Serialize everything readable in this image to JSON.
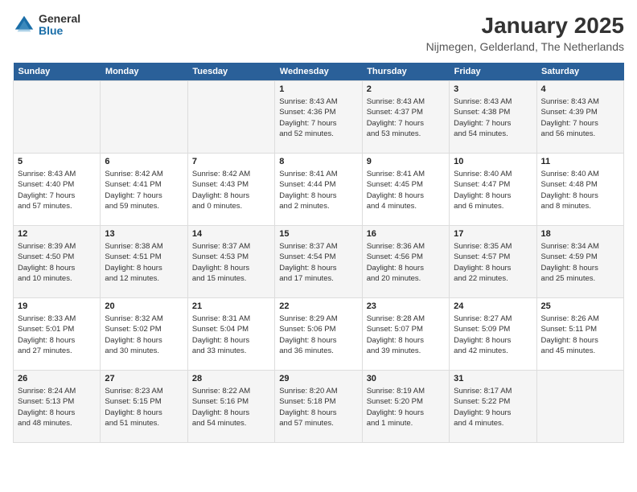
{
  "logo": {
    "general": "General",
    "blue": "Blue"
  },
  "title": "January 2025",
  "subtitle": "Nijmegen, Gelderland, The Netherlands",
  "weekdays": [
    "Sunday",
    "Monday",
    "Tuesday",
    "Wednesday",
    "Thursday",
    "Friday",
    "Saturday"
  ],
  "weeks": [
    [
      {
        "day": "",
        "info": ""
      },
      {
        "day": "",
        "info": ""
      },
      {
        "day": "",
        "info": ""
      },
      {
        "day": "1",
        "info": "Sunrise: 8:43 AM\nSunset: 4:36 PM\nDaylight: 7 hours\nand 52 minutes."
      },
      {
        "day": "2",
        "info": "Sunrise: 8:43 AM\nSunset: 4:37 PM\nDaylight: 7 hours\nand 53 minutes."
      },
      {
        "day": "3",
        "info": "Sunrise: 8:43 AM\nSunset: 4:38 PM\nDaylight: 7 hours\nand 54 minutes."
      },
      {
        "day": "4",
        "info": "Sunrise: 8:43 AM\nSunset: 4:39 PM\nDaylight: 7 hours\nand 56 minutes."
      }
    ],
    [
      {
        "day": "5",
        "info": "Sunrise: 8:43 AM\nSunset: 4:40 PM\nDaylight: 7 hours\nand 57 minutes."
      },
      {
        "day": "6",
        "info": "Sunrise: 8:42 AM\nSunset: 4:41 PM\nDaylight: 7 hours\nand 59 minutes."
      },
      {
        "day": "7",
        "info": "Sunrise: 8:42 AM\nSunset: 4:43 PM\nDaylight: 8 hours\nand 0 minutes."
      },
      {
        "day": "8",
        "info": "Sunrise: 8:41 AM\nSunset: 4:44 PM\nDaylight: 8 hours\nand 2 minutes."
      },
      {
        "day": "9",
        "info": "Sunrise: 8:41 AM\nSunset: 4:45 PM\nDaylight: 8 hours\nand 4 minutes."
      },
      {
        "day": "10",
        "info": "Sunrise: 8:40 AM\nSunset: 4:47 PM\nDaylight: 8 hours\nand 6 minutes."
      },
      {
        "day": "11",
        "info": "Sunrise: 8:40 AM\nSunset: 4:48 PM\nDaylight: 8 hours\nand 8 minutes."
      }
    ],
    [
      {
        "day": "12",
        "info": "Sunrise: 8:39 AM\nSunset: 4:50 PM\nDaylight: 8 hours\nand 10 minutes."
      },
      {
        "day": "13",
        "info": "Sunrise: 8:38 AM\nSunset: 4:51 PM\nDaylight: 8 hours\nand 12 minutes."
      },
      {
        "day": "14",
        "info": "Sunrise: 8:37 AM\nSunset: 4:53 PM\nDaylight: 8 hours\nand 15 minutes."
      },
      {
        "day": "15",
        "info": "Sunrise: 8:37 AM\nSunset: 4:54 PM\nDaylight: 8 hours\nand 17 minutes."
      },
      {
        "day": "16",
        "info": "Sunrise: 8:36 AM\nSunset: 4:56 PM\nDaylight: 8 hours\nand 20 minutes."
      },
      {
        "day": "17",
        "info": "Sunrise: 8:35 AM\nSunset: 4:57 PM\nDaylight: 8 hours\nand 22 minutes."
      },
      {
        "day": "18",
        "info": "Sunrise: 8:34 AM\nSunset: 4:59 PM\nDaylight: 8 hours\nand 25 minutes."
      }
    ],
    [
      {
        "day": "19",
        "info": "Sunrise: 8:33 AM\nSunset: 5:01 PM\nDaylight: 8 hours\nand 27 minutes."
      },
      {
        "day": "20",
        "info": "Sunrise: 8:32 AM\nSunset: 5:02 PM\nDaylight: 8 hours\nand 30 minutes."
      },
      {
        "day": "21",
        "info": "Sunrise: 8:31 AM\nSunset: 5:04 PM\nDaylight: 8 hours\nand 33 minutes."
      },
      {
        "day": "22",
        "info": "Sunrise: 8:29 AM\nSunset: 5:06 PM\nDaylight: 8 hours\nand 36 minutes."
      },
      {
        "day": "23",
        "info": "Sunrise: 8:28 AM\nSunset: 5:07 PM\nDaylight: 8 hours\nand 39 minutes."
      },
      {
        "day": "24",
        "info": "Sunrise: 8:27 AM\nSunset: 5:09 PM\nDaylight: 8 hours\nand 42 minutes."
      },
      {
        "day": "25",
        "info": "Sunrise: 8:26 AM\nSunset: 5:11 PM\nDaylight: 8 hours\nand 45 minutes."
      }
    ],
    [
      {
        "day": "26",
        "info": "Sunrise: 8:24 AM\nSunset: 5:13 PM\nDaylight: 8 hours\nand 48 minutes."
      },
      {
        "day": "27",
        "info": "Sunrise: 8:23 AM\nSunset: 5:15 PM\nDaylight: 8 hours\nand 51 minutes."
      },
      {
        "day": "28",
        "info": "Sunrise: 8:22 AM\nSunset: 5:16 PM\nDaylight: 8 hours\nand 54 minutes."
      },
      {
        "day": "29",
        "info": "Sunrise: 8:20 AM\nSunset: 5:18 PM\nDaylight: 8 hours\nand 57 minutes."
      },
      {
        "day": "30",
        "info": "Sunrise: 8:19 AM\nSunset: 5:20 PM\nDaylight: 9 hours\nand 1 minute."
      },
      {
        "day": "31",
        "info": "Sunrise: 8:17 AM\nSunset: 5:22 PM\nDaylight: 9 hours\nand 4 minutes."
      },
      {
        "day": "",
        "info": ""
      }
    ]
  ]
}
